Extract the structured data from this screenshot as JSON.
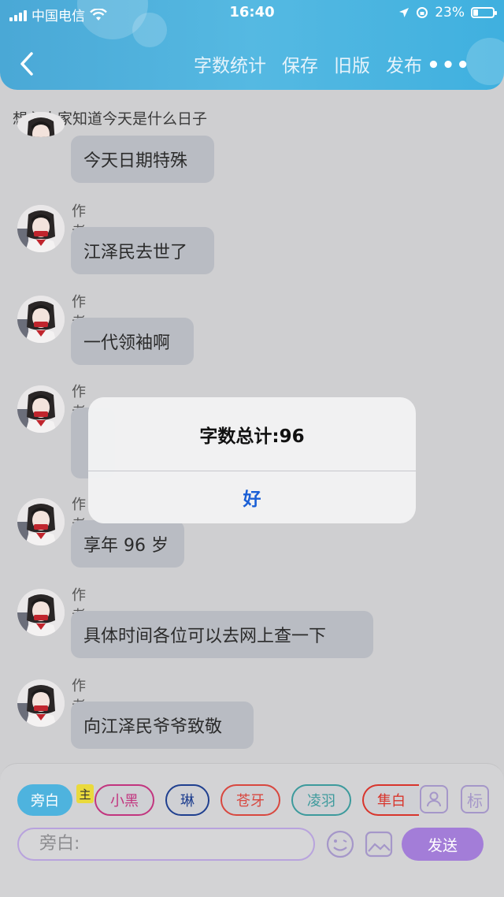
{
  "status_bar": {
    "carrier": "中国电信",
    "time": "16:40",
    "battery": "23%",
    "battery_level": 0.23
  },
  "nav": {
    "items": [
      "字数统计",
      "保存",
      "旧版",
      "发布"
    ],
    "more": "•••"
  },
  "story_title": "想必大家知道今天是什么日子",
  "messages": [
    {
      "author": "",
      "text": "今天日期特殊"
    },
    {
      "author": "作者",
      "text": "江泽民去世了"
    },
    {
      "author": "作者",
      "text": "一代领袖啊"
    },
    {
      "author": "作者",
      "text": ""
    },
    {
      "author": "作者",
      "text": "享年 96 岁"
    },
    {
      "author": "作者",
      "text": "具体时间各位可以去网上查一下"
    },
    {
      "author": "作者",
      "text": "向江泽民爷爷致敬"
    }
  ],
  "alert": {
    "message": "字数总计:96",
    "ok": "好"
  },
  "composer": {
    "roles": [
      {
        "label": "旁白",
        "color": "#4eb3de",
        "active": true
      },
      {
        "label": "小黑",
        "color": "#c2357f"
      },
      {
        "label": "琳",
        "color": "#1f3f8f"
      },
      {
        "label": "苍牙",
        "color": "#d8473f"
      },
      {
        "label": "凌羽",
        "color": "#3c9a9c"
      },
      {
        "label": "隼白",
        "color": "#d8352c"
      }
    ],
    "host_tag": "主",
    "mark_button": "标",
    "input_placeholder": "旁白:",
    "send_label": "发送"
  },
  "colors": {
    "header": "#4aa8d6",
    "bubble": "#b9bcc3",
    "send": "#a37dd8",
    "alert_ok": "#1a5fd6"
  }
}
